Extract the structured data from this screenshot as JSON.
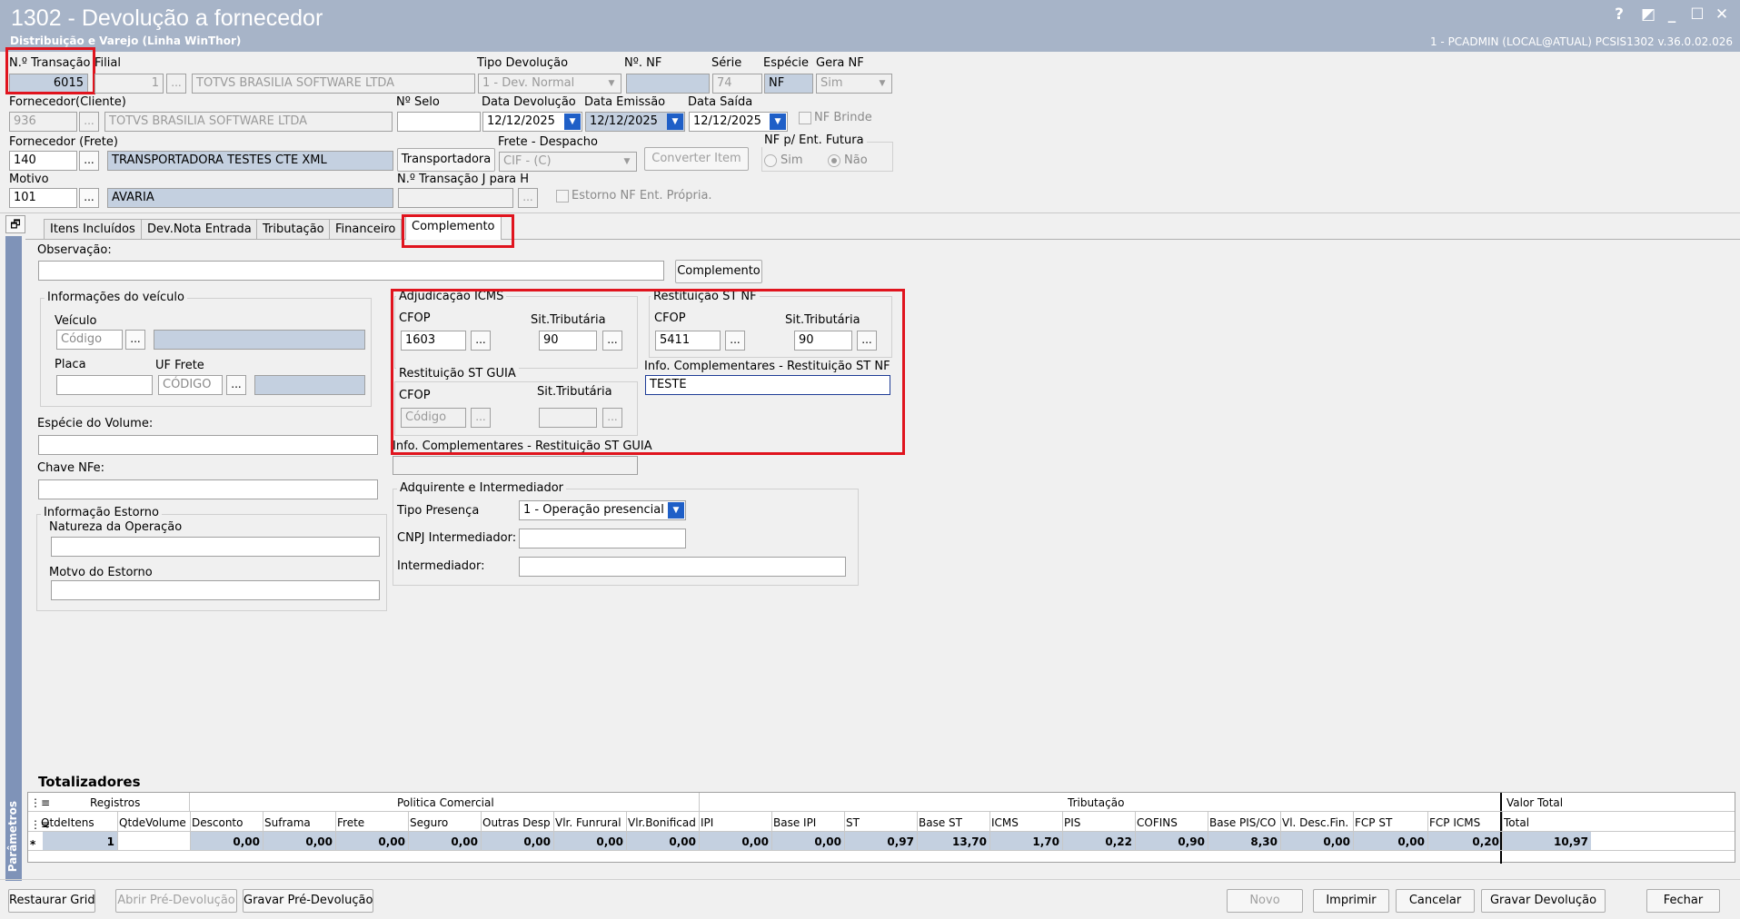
{
  "window": {
    "title": "1302 - Devolução a fornecedor",
    "subtitle": "Distribuição e Varejo (Linha WinThor)",
    "status": "1 - PCADMIN (LOCAL@ATUAL)   PCSIS1302  v.36.0.02.026",
    "help": "?",
    "restore_glyph": "◩",
    "minimize_glyph": "_",
    "maximize_glyph": "☐",
    "close_glyph": "✕"
  },
  "header": {
    "transacao_label": "N.º Transação",
    "transacao_value": "6015",
    "filial_label": "Filial",
    "filial_code": "1",
    "filial_name": "TOTVS BRASILIA SOFTWARE LTDA",
    "tipo_dev_label": "Tipo Devolução",
    "tipo_dev_value": "1 - Dev. Normal",
    "nf_label": "Nº. NF",
    "nf_value": "",
    "serie_label": "Série",
    "serie_value": "74",
    "especie_label": "Espécie",
    "especie_value": "NF",
    "gera_nf_label": "Gera NF",
    "gera_nf_value": "Sim",
    "fornecedor_label": "Fornecedor(Cliente)",
    "fornecedor_code": "936",
    "fornecedor_name": "TOTVS BRASILIA SOFTWARE LTDA",
    "selo_label": "Nº Selo",
    "selo_value": "",
    "data_dev_label": "Data Devolução",
    "data_dev_value": "12/12/2025",
    "data_emissao_label": "Data Emissão",
    "data_emissao_value": "12/12/2025",
    "data_saida_label": "Data Saída",
    "data_saida_value": "12/12/2025",
    "nf_brinde_label": "NF Brinde",
    "frete_label": "Fornecedor (Frete)",
    "frete_code": "140",
    "frete_name": "TRANSPORTADORA TESTES CTE XML",
    "transportadora_btn": "Transportadora",
    "frete_despacho_label": "Frete - Despacho",
    "frete_despacho_value": "CIF - (C)",
    "converter_btn": "Converter Item",
    "nf_futura_label": "NF p/ Ent. Futura",
    "sim_label": "Sim",
    "nao_label": "Não",
    "motivo_label": "Motivo",
    "motivo_code": "101",
    "motivo_name": "AVARIA",
    "transacao_j_label": "N.º Transação J para H",
    "transacao_j_value": "",
    "estorno_label": "Estorno NF Ent. Própria.",
    "ellipsis": "..."
  },
  "tabs": [
    "Itens Incluídos",
    "Dev.Nota Entrada",
    "Tributação",
    "Financeiro",
    "Complemento"
  ],
  "sidebar_label": "Parâmetros",
  "complemento": {
    "obs_label": "Observação:",
    "obs_value": "",
    "complemento_btn": "Complemento",
    "veiculo_group": "Informações do veículo",
    "veiculo_label": "Veículo",
    "veiculo_placeholder": "Código",
    "placa_label": "Placa",
    "uf_frete_label": "UF Frete",
    "uf_frete_placeholder": "CÓDIGO",
    "especie_vol_label": "Espécie do Volume:",
    "chave_label": "Chave NFe:",
    "estorno_group": "Informação Estorno",
    "natureza_label": "Natureza da Operação",
    "motivo_estorno_label": "Motvo do Estorno",
    "adj_group": "Adjudicação ICMS",
    "cfop_label": "CFOP",
    "sit_label": "Sit.Tributária",
    "adj_cfop": "1603",
    "adj_sit": "90",
    "rest_nf_group": "Restituição ST NF",
    "rest_nf_cfop": "5411",
    "rest_nf_sit": "90",
    "rest_guia_group": "Restituição ST GUIA",
    "rest_guia_cfop_placeholder": "Código",
    "info_nf_label": "Info. Complementares - Restituição ST NF",
    "info_nf_value": "TESTE",
    "info_guia_label": "Info. Complementares - Restituição ST GUIA",
    "adq_group": "Adquirente e Intermediador",
    "presenca_label": "Tipo Presença",
    "presenca_value": "1 - Operação presencial",
    "cnpj_label": "CNPJ Intermediador:",
    "inter_label": "Intermediador:"
  },
  "totalizadores": {
    "title": "Totalizadores",
    "groups": {
      "registros": "Registros",
      "politica": "Politica Comercial",
      "tributacao": "Tributação",
      "valor_total": "Valor Total"
    },
    "columns": [
      "QtdeItens",
      "QtdeVolume",
      "Desconto",
      "Suframa",
      "Frete",
      "Seguro",
      "Outras Desp",
      "Vlr. Funrural",
      "Vlr.Bonificad",
      "IPI",
      "Base IPI",
      "ST",
      "Base ST",
      "ICMS",
      "PIS",
      "COFINS",
      "Base PIS/CO",
      "Vl. Desc.Fin.",
      "FCP ST",
      "FCP ICMS",
      "Total"
    ],
    "values": [
      "1",
      "",
      "0,00",
      "0,00",
      "0,00",
      "0,00",
      "0,00",
      "0,00",
      "0,00",
      "0,00",
      "0,00",
      "0,97",
      "13,70",
      "1,70",
      "0,22",
      "0,90",
      "8,30",
      "0,00",
      "0,00",
      "0,20",
      "10,97"
    ],
    "row_marker": "*"
  },
  "footer": {
    "restaurar": "Restaurar Grid",
    "abrir": "Abrir Pré-Devolução",
    "gravar_pre": "Gravar Pré-Devolução",
    "novo": "Novo",
    "imprimir": "Imprimir",
    "cancelar": "Cancelar",
    "gravar": "Gravar Devolução",
    "fechar": "Fechar"
  },
  "colors": {
    "titlebar": "#a7b4c8",
    "highlight": "#e0141e",
    "field_blue": "#c4d0e0",
    "sidebar": "#7f93b8"
  }
}
